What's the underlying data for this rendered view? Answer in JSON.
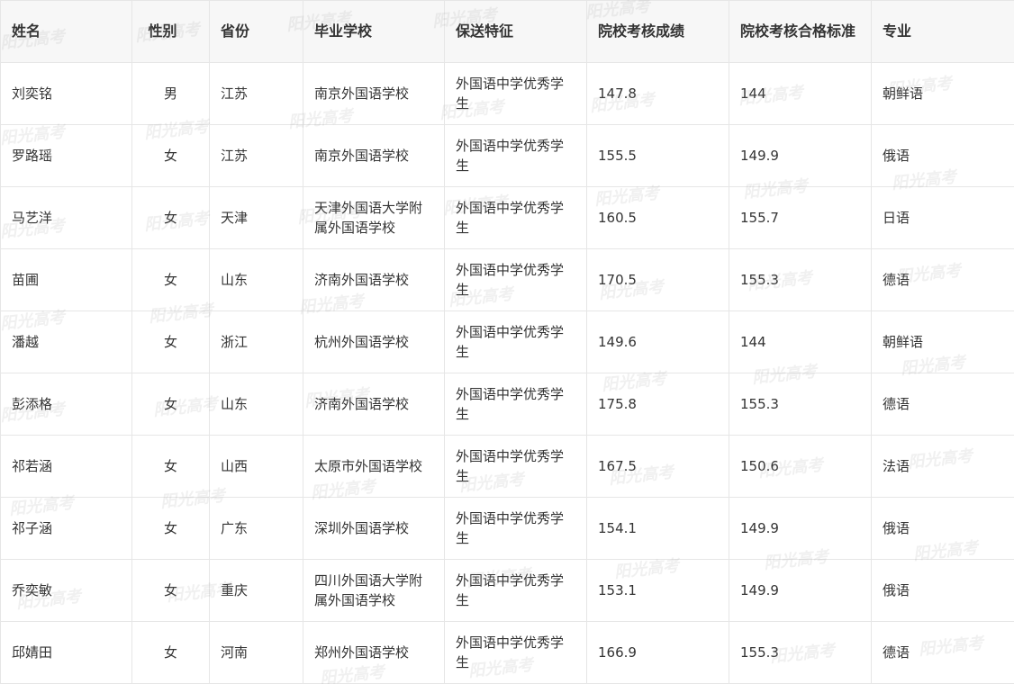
{
  "table": {
    "headers": {
      "name": "姓名",
      "gender": "性别",
      "province": "省份",
      "school": "毕业学校",
      "feature": "保送特征",
      "score": "院校考核成绩",
      "standard": "院校考核合格标准",
      "major": "专业"
    },
    "rows": [
      {
        "name": "刘奕铭",
        "gender": "男",
        "province": "江苏",
        "school": "南京外国语学校",
        "feature": "外国语中学优秀学生",
        "score": "147.8",
        "standard": "144",
        "major": "朝鲜语"
      },
      {
        "name": "罗路瑶",
        "gender": "女",
        "province": "江苏",
        "school": "南京外国语学校",
        "feature": "外国语中学优秀学生",
        "score": "155.5",
        "standard": "149.9",
        "major": "俄语"
      },
      {
        "name": "马艺洋",
        "gender": "女",
        "province": "天津",
        "school": "天津外国语大学附属外国语学校",
        "feature": "外国语中学优秀学生",
        "score": "160.5",
        "standard": "155.7",
        "major": "日语"
      },
      {
        "name": "苗圃",
        "gender": "女",
        "province": "山东",
        "school": "济南外国语学校",
        "feature": "外国语中学优秀学生",
        "score": "170.5",
        "standard": "155.3",
        "major": "德语"
      },
      {
        "name": "潘越",
        "gender": "女",
        "province": "浙江",
        "school": "杭州外国语学校",
        "feature": "外国语中学优秀学生",
        "score": "149.6",
        "standard": "144",
        "major": "朝鲜语"
      },
      {
        "name": "彭添格",
        "gender": "女",
        "province": "山东",
        "school": "济南外国语学校",
        "feature": "外国语中学优秀学生",
        "score": "175.8",
        "standard": "155.3",
        "major": "德语"
      },
      {
        "name": "祁若涵",
        "gender": "女",
        "province": "山西",
        "school": "太原市外国语学校",
        "feature": "外国语中学优秀学生",
        "score": "167.5",
        "standard": "150.6",
        "major": "法语"
      },
      {
        "name": "祁子涵",
        "gender": "女",
        "province": "广东",
        "school": "深圳外国语学校",
        "feature": "外国语中学优秀学生",
        "score": "154.1",
        "standard": "149.9",
        "major": "俄语"
      },
      {
        "name": "乔奕敏",
        "gender": "女",
        "province": "重庆",
        "school": "四川外国语大学附属外国语学校",
        "feature": "外国语中学优秀学生",
        "score": "153.1",
        "standard": "149.9",
        "major": "俄语"
      },
      {
        "name": "邱婧田",
        "gender": "女",
        "province": "河南",
        "school": "郑州外国语学校",
        "feature": "外国语中学优秀学生",
        "score": "166.9",
        "standard": "155.3",
        "major": "德语"
      }
    ]
  },
  "watermark": {
    "text": "阳光高考",
    "color": "#969696"
  }
}
